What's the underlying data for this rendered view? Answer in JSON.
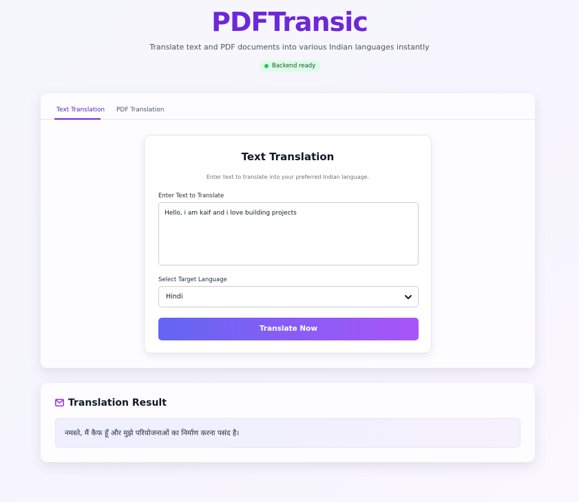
{
  "header": {
    "title": "PDFTransic",
    "subtitle": "Translate text and PDF documents into various Indian languages instantly",
    "status_badge": "Backend ready"
  },
  "tabs": [
    {
      "label": "Text Translation",
      "active": true
    },
    {
      "label": "PDF Translation",
      "active": false
    }
  ],
  "text_translation": {
    "title": "Text Translation",
    "description": "Enter text to translate into your preferred Indian language.",
    "input_label": "Enter Text to Translate",
    "input_value": "Hello, i am kaif and i love building projects",
    "language_label": "Select Target Language",
    "language_selected": "Hindi",
    "button_label": "Translate Now"
  },
  "result": {
    "title": "Translation Result",
    "icon": "envelope-icon",
    "text": "नमस्ते, मैं कैफ हूँ और मुझे परियोजनाओं का निर्माण करना पसंद है।"
  },
  "colors": {
    "brand": "#6d28d9",
    "badge_bg": "#dcfce7",
    "status_dot": "#22c55e",
    "button_gradient_start": "#6366f1",
    "button_gradient_end": "#a855f7"
  }
}
